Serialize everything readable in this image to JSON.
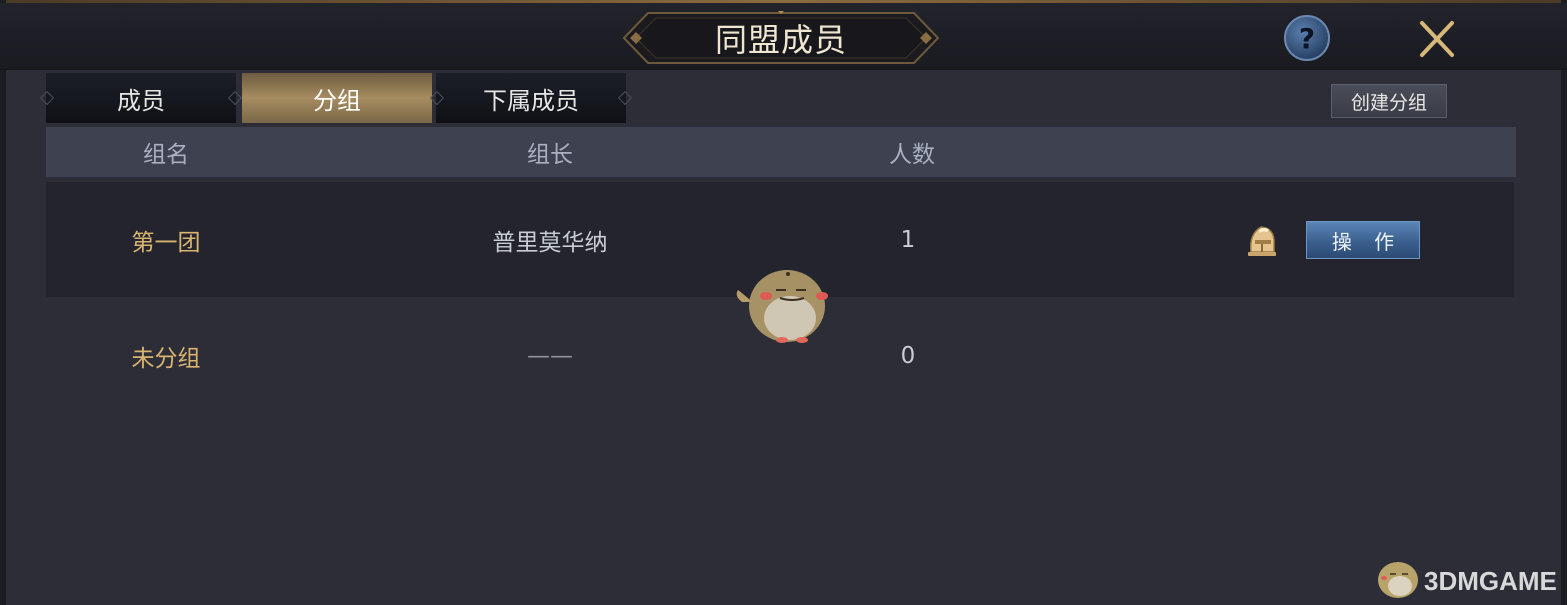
{
  "header": {
    "title": "同盟成员"
  },
  "tabs": [
    {
      "label": "成员",
      "active": false
    },
    {
      "label": "分组",
      "active": true
    },
    {
      "label": "下属成员",
      "active": false
    }
  ],
  "toolbar": {
    "create_group_label": "创建分组"
  },
  "table": {
    "columns": [
      "组名",
      "组长",
      "人数"
    ],
    "rows": [
      {
        "group": "第一团",
        "leader": "普里莫华纳",
        "count": "1",
        "action": "操 作"
      },
      {
        "group": "未分组",
        "leader": "——",
        "count": "0"
      }
    ]
  },
  "watermark": {
    "text": "3DMGAME"
  },
  "colors": {
    "accent_gold": "#d9b46f",
    "button_blue": "#3a5f8e",
    "tab_active": "#a68c60"
  },
  "icons": {
    "help": "question-mark-icon",
    "close": "close-icon",
    "leader": "helmet-icon"
  }
}
